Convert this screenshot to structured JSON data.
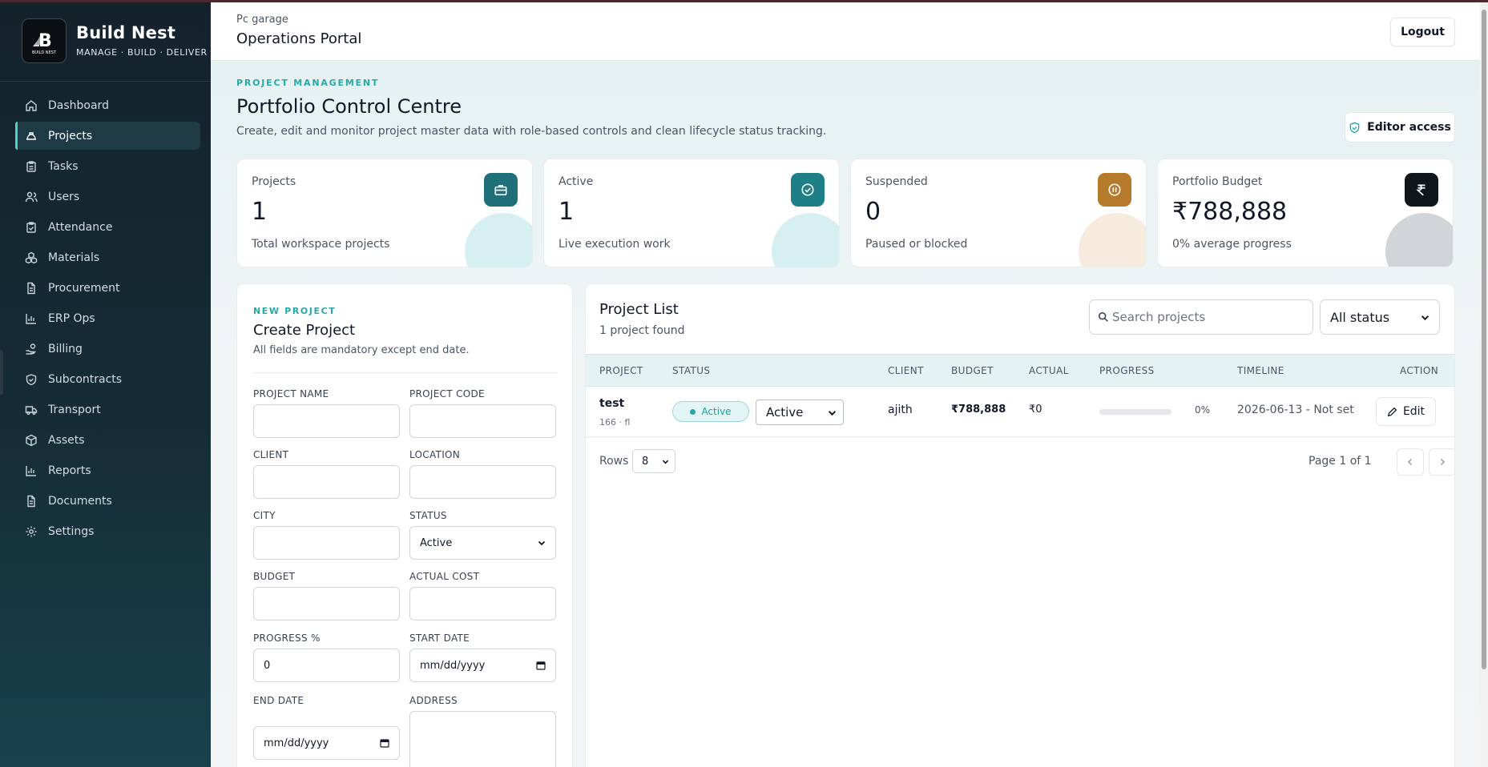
{
  "brand": {
    "name": "Build Nest",
    "tagline": "MANAGE · BUILD · DELIVER",
    "logo_text": "BUILD NEST"
  },
  "sidebar": {
    "items": [
      {
        "label": "Dashboard",
        "icon": "home-icon"
      },
      {
        "label": "Projects",
        "icon": "hard-hat-icon",
        "active": true
      },
      {
        "label": "Tasks",
        "icon": "clipboard-icon"
      },
      {
        "label": "Users",
        "icon": "users-icon"
      },
      {
        "label": "Attendance",
        "icon": "clipboard-check-icon"
      },
      {
        "label": "Materials",
        "icon": "boxes-icon"
      },
      {
        "label": "Procurement",
        "icon": "file-icon"
      },
      {
        "label": "ERP Ops",
        "icon": "bar-chart-icon"
      },
      {
        "label": "Billing",
        "icon": "hand-coins-icon"
      },
      {
        "label": "Subcontracts",
        "icon": "handshake-icon"
      },
      {
        "label": "Transport",
        "icon": "truck-icon"
      },
      {
        "label": "Assets",
        "icon": "package-icon"
      },
      {
        "label": "Reports",
        "icon": "bar-chart-icon"
      },
      {
        "label": "Documents",
        "icon": "document-icon"
      },
      {
        "label": "Settings",
        "icon": "gear-icon"
      }
    ]
  },
  "header": {
    "org": "Pc garage",
    "title": "Operations Portal",
    "logout_label": "Logout"
  },
  "page": {
    "eyebrow": "PROJECT MANAGEMENT",
    "title": "Portfolio Control Centre",
    "description": "Create, edit and monitor project master data with role-based controls and clean lifecycle status tracking.",
    "access_label": "Editor access"
  },
  "stats": [
    {
      "label": "Projects",
      "value": "1",
      "sub": "Total workspace projects",
      "icon": "briefcase-icon",
      "color": "#1f6f78"
    },
    {
      "label": "Active",
      "value": "1",
      "sub": "Live execution work",
      "icon": "check-circle-icon",
      "color": "#1f7f86"
    },
    {
      "label": "Suspended",
      "value": "0",
      "sub": "Paused or blocked",
      "icon": "pause-circle-icon",
      "color": "#b57a2a"
    },
    {
      "label": "Portfolio Budget",
      "value": "₹788,888",
      "sub": "0% average progress",
      "icon": "rupee-icon",
      "color": "#0f171c"
    }
  ],
  "form": {
    "eyebrow": "NEW PROJECT",
    "title": "Create Project",
    "description": "All fields are mandatory except end date.",
    "fields": {
      "project_name": {
        "label": "PROJECT NAME",
        "value": ""
      },
      "project_code": {
        "label": "PROJECT CODE",
        "value": ""
      },
      "client": {
        "label": "CLIENT",
        "value": ""
      },
      "location": {
        "label": "LOCATION",
        "value": ""
      },
      "city": {
        "label": "CITY",
        "value": ""
      },
      "status": {
        "label": "STATUS",
        "value": "Active"
      },
      "budget": {
        "label": "BUDGET",
        "value": ""
      },
      "actual_cost": {
        "label": "ACTUAL COST",
        "value": ""
      },
      "progress": {
        "label": "PROGRESS %",
        "value": "0"
      },
      "start_date": {
        "label": "START DATE",
        "value": "mm/dd/yyyy"
      },
      "end_date": {
        "label": "END DATE",
        "value": "mm/dd/yyyy"
      },
      "address": {
        "label": "ADDRESS",
        "value": ""
      }
    }
  },
  "list": {
    "title": "Project List",
    "count": "1 project found",
    "search_placeholder": "Search projects",
    "status_filter": "All status",
    "columns": [
      "PROJECT",
      "STATUS",
      "CLIENT",
      "BUDGET",
      "ACTUAL",
      "PROGRESS",
      "TIMELINE",
      "ACTION"
    ],
    "rows": [
      {
        "name": "test",
        "meta": "166 · fl",
        "status_pill": "Active",
        "status_select": "Active",
        "client": "ajith",
        "budget": "₹788,888",
        "actual": "₹0",
        "progress_pct": "0%",
        "progress": 0,
        "timeline": "2026-06-13 - Not set",
        "action": "Edit"
      }
    ],
    "rows_label": "Rows",
    "rows_value": "8",
    "page_info": "Page 1 of 1"
  },
  "colors": {
    "accent": "#27a9a9",
    "sidebar_bg": "#152c36"
  }
}
